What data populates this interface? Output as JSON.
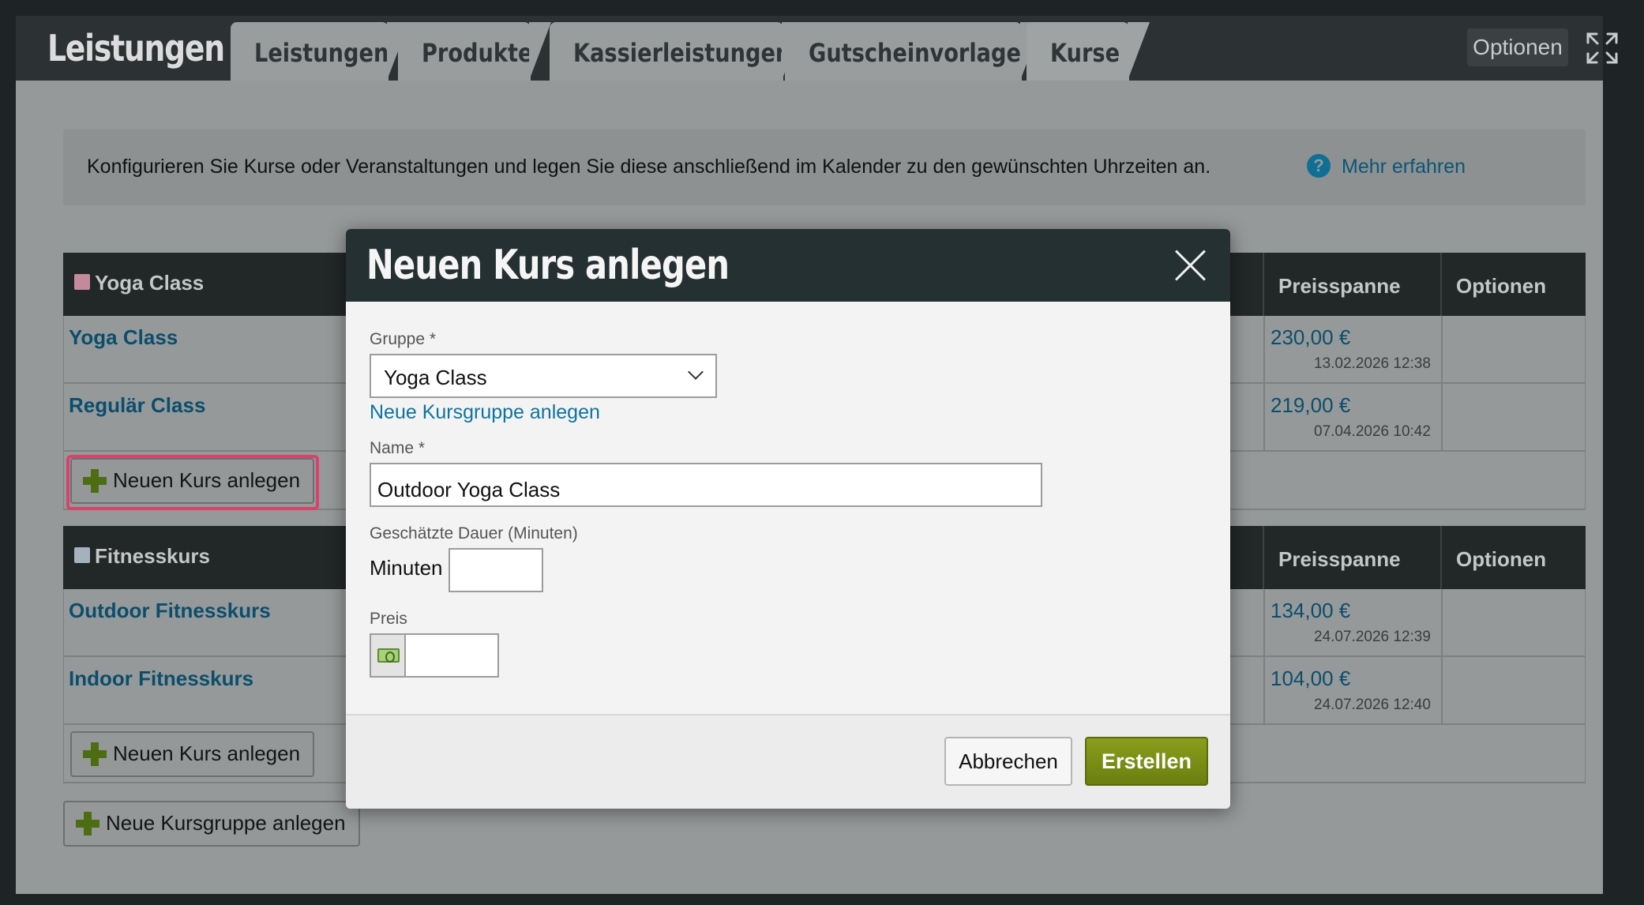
{
  "header": {
    "app_title": "Leistungen",
    "tabs": [
      {
        "label": "Leistungen"
      },
      {
        "label": "Produkte"
      },
      {
        "label": "Kassierleistungen"
      },
      {
        "label": "Gutscheinvorlagen"
      },
      {
        "label": "Kurse",
        "active": true
      }
    ],
    "options_label": "Optionen",
    "expand_icon": "expand-icon"
  },
  "info": {
    "text": "Konfigurieren Sie Kurse oder Veranstaltungen und legen Sie diese anschließend im Kalender zu den gewünschten Uhrzeiten an.",
    "help_icon": "?",
    "link": "Mehr erfahren"
  },
  "columns": {
    "price": "Preisspanne",
    "options": "Optionen"
  },
  "groups": [
    {
      "name": "Yoga Class",
      "color": "#c48a9c",
      "courses": [
        {
          "name": "Yoga Class",
          "price": "230,00 €",
          "date": "13.02.2026 12:38"
        },
        {
          "name": "Regulär Class",
          "price": "219,00 €",
          "date": "07.04.2026 10:42"
        }
      ],
      "add_course_label": "Neuen Kurs anlegen"
    },
    {
      "name": "Fitnesskurs",
      "color": "#a3b2bd",
      "courses": [
        {
          "name": "Outdoor Fitnesskurs",
          "price": "134,00 €",
          "date": "24.07.2026 12:39"
        },
        {
          "name": "Indoor Fitnesskurs",
          "price": "104,00 €",
          "date": "24.07.2026 12:40"
        }
      ],
      "add_course_label": "Neuen Kurs anlegen"
    }
  ],
  "add_group_label": "Neue Kursgruppe anlegen",
  "modal": {
    "title": "Neuen Kurs anlegen",
    "group_label": "Gruppe *",
    "group_value": "Yoga Class",
    "new_group_link": "Neue Kursgruppe anlegen",
    "name_label": "Name *",
    "name_value": "Outdoor Yoga Class",
    "duration_label": "Geschätzte Dauer (Minuten)",
    "minutes_label": "Minuten",
    "minutes_value": "",
    "price_label": "Preis",
    "price_value": "",
    "money_icon": "money-icon",
    "cancel_label": "Abbrechen",
    "create_label": "Erstellen"
  },
  "colors": {
    "accent": "#0f73a0",
    "create_button": "#7a8e16",
    "highlight": "#d9436b"
  }
}
